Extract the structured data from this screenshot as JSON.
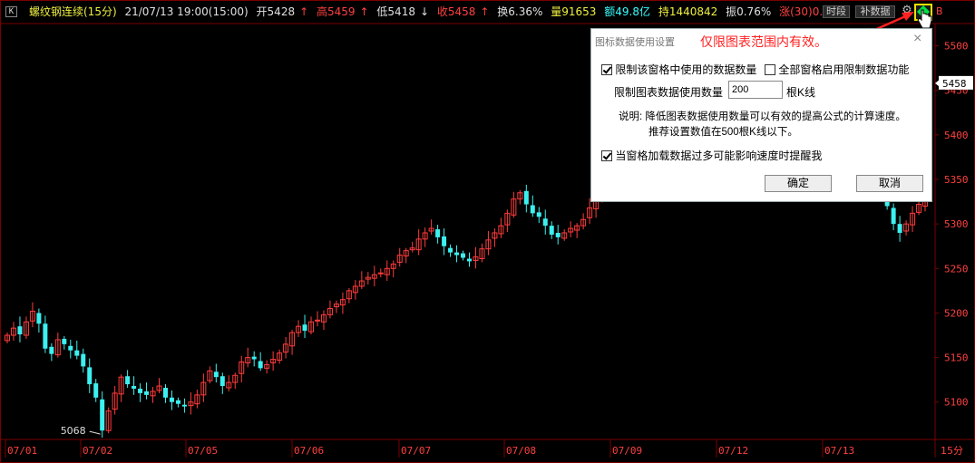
{
  "header": {
    "k_badge": "K",
    "title": "螺纹钢连续(15分)",
    "datetime": "21/07/13 19:00(15:00)",
    "open": "开5428",
    "high_label": "高5459",
    "low_label": "低5418",
    "close_label": "收5458",
    "turnover": "换6.36%",
    "volume": "量91653",
    "amount": "额49.8亿",
    "hold": "持1440842",
    "amplitude": "振0.76%",
    "change": "涨(30)0.55%",
    "btn_period": "时段",
    "btn_data": "补数据",
    "right_sym": "B"
  },
  "colors": {
    "up": "#ff3c3c",
    "down": "#3cf0f0",
    "bg": "#000000",
    "grid": "#7a0000",
    "axis_text": "#ff4040"
  },
  "chart_data": {
    "type": "candlestick",
    "period": "15分",
    "y_ticks": [
      5100,
      5150,
      5200,
      5250,
      5300,
      5350,
      5400,
      5450,
      5500
    ],
    "ylim": [
      5058,
      5524
    ],
    "x_ticks": [
      "07/01",
      "07/02",
      "07/05",
      "07/06",
      "07/07",
      "07/08",
      "07/09",
      "07/12",
      "07/13"
    ],
    "last_price": "5458",
    "low_annotation": "5068",
    "closes": [
      5175,
      5183,
      5176,
      5190,
      5202,
      5188,
      5160,
      5154,
      5170,
      5165,
      5158,
      5152,
      5140,
      5120,
      5105,
      5068,
      5090,
      5110,
      5128,
      5120,
      5115,
      5110,
      5108,
      5112,
      5118,
      5105,
      5100,
      5098,
      5095,
      5100,
      5108,
      5122,
      5135,
      5128,
      5118,
      5122,
      5130,
      5145,
      5150,
      5148,
      5138,
      5142,
      5148,
      5155,
      5165,
      5178,
      5185,
      5180,
      5190,
      5192,
      5198,
      5205,
      5210,
      5215,
      5225,
      5230,
      5236,
      5240,
      5243,
      5245,
      5250,
      5255,
      5265,
      5270,
      5273,
      5283,
      5290,
      5295,
      5285,
      5275,
      5268,
      5265,
      5262,
      5258,
      5263,
      5272,
      5282,
      5290,
      5298,
      5312,
      5328,
      5335,
      5322,
      5312,
      5308,
      5298,
      5288,
      5285,
      5290,
      5295,
      5298,
      5305,
      5318,
      5328,
      5335,
      5345,
      5350,
      5355,
      5345,
      5350,
      5368,
      5388,
      5405,
      5415,
      5422,
      5430,
      5440,
      5448,
      5455,
      5462,
      5445,
      5432,
      5428,
      5420,
      5412,
      5400,
      5390,
      5395,
      5402,
      5408,
      5400,
      5396,
      5390,
      5384,
      5380,
      5386,
      5392,
      5398,
      5404,
      5410,
      5406,
      5400,
      5396,
      5392,
      5388,
      5380,
      5370,
      5355,
      5340,
      5320,
      5300,
      5290,
      5300,
      5312,
      5322,
      5332
    ]
  },
  "dialog": {
    "title": "图标数据使用设置",
    "note": "仅限图表范围内有效。",
    "close": "×",
    "chk_limit_label": "限制该窗格中使用的数据数量",
    "chk_limit_checked": true,
    "chk_all_label": "全部窗格启用限制数据功能",
    "chk_all_checked": false,
    "count_label": "限制图表数据使用数量",
    "count_value": "200",
    "count_unit": "根K线",
    "desc_line1": "说明: 降低图表数据使用数量可以有效的提高公式的计算速度。",
    "desc_line2": "推荐设置数值在500根K线以下。",
    "chk_remind_label": "当窗格加载数据过多可能影响速度时提醒我",
    "chk_remind_checked": true,
    "ok": "确定",
    "cancel": "取消"
  }
}
